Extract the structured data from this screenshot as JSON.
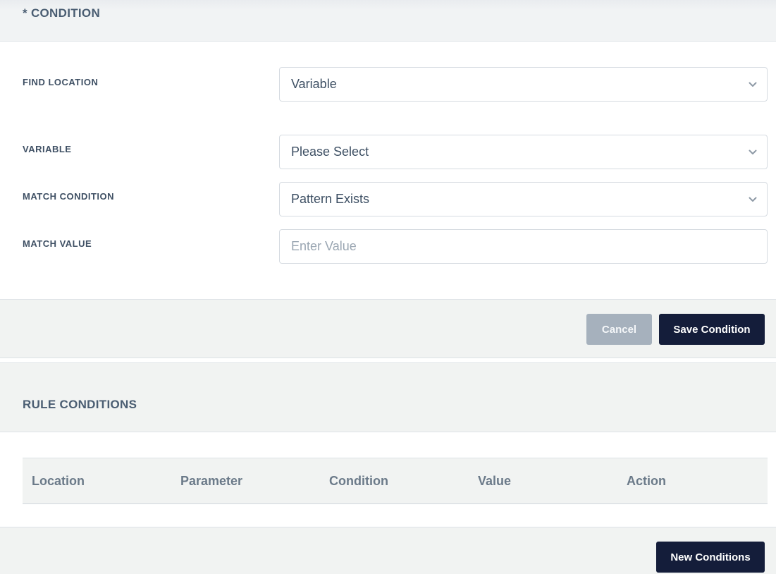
{
  "condition_section": {
    "title": "* CONDITION"
  },
  "form": {
    "find_location": {
      "label": "FIND LOCATION",
      "value": "Variable",
      "icon": "chevron-down-icon"
    },
    "variable": {
      "label": "VARIABLE",
      "value": "Please Select",
      "icon": "chevron-down-icon"
    },
    "match_condition": {
      "label": "MATCH CONDITION",
      "value": "Pattern Exists",
      "icon": "chevron-down-icon"
    },
    "match_value": {
      "label": "MATCH VALUE",
      "value": "",
      "placeholder": "Enter Value"
    }
  },
  "actions": {
    "cancel_label": "Cancel",
    "save_label": "Save Condition"
  },
  "rules_section": {
    "title": "RULE CONDITIONS",
    "columns": [
      "Location",
      "Parameter",
      "Condition",
      "Value",
      "Action"
    ],
    "rows": [],
    "new_label": "New Conditions"
  },
  "colors": {
    "primary_button": "#141d3a",
    "cancel_button": "#a6b1bd",
    "section_bg": "#f1f3f2",
    "title_text": "#4a5d72"
  }
}
